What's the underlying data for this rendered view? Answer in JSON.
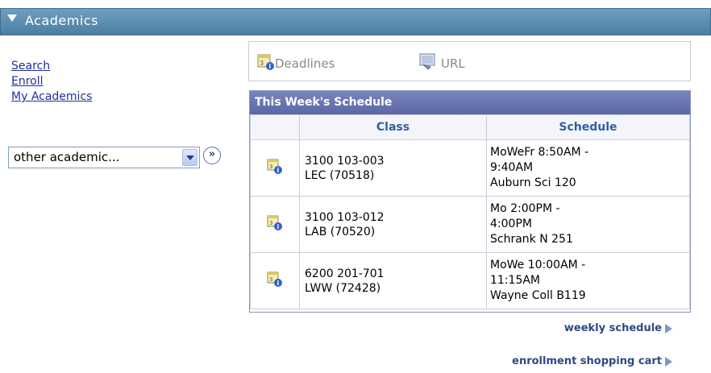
{
  "header": {
    "title": "Academics"
  },
  "links": [
    "Search",
    "Enroll",
    "My Academics"
  ],
  "dropdown": {
    "selected": "other academic..."
  },
  "go_button": {
    "label": "»"
  },
  "toolbar": {
    "deadlines_label": "Deadlines",
    "url_label": "URL"
  },
  "schedule": {
    "title": "This Week's Schedule",
    "columns": {
      "class": "Class",
      "schedule": "Schedule"
    },
    "rows": [
      {
        "class_line1": "3100 103-003",
        "class_line2": "LEC (70518)",
        "sched_line1": "MoWeFr 8:50AM -",
        "sched_line2": "9:40AM",
        "sched_line3": "Auburn Sci 120"
      },
      {
        "class_line1": "3100 103-012",
        "class_line2": "LAB (70520)",
        "sched_line1": "Mo 2:00PM -",
        "sched_line2": "4:00PM",
        "sched_line3": "Schrank N 251"
      },
      {
        "class_line1": "6200 201-701",
        "class_line2": "LWW (72428)",
        "sched_line1": "MoWe 10:00AM -",
        "sched_line2": "11:15AM",
        "sched_line3": "Wayne Coll B119"
      }
    ]
  },
  "bottom_links": {
    "weekly": "weekly schedule",
    "cart": "enrollment shopping cart"
  },
  "icons": [
    "triangle-down-icon",
    "deadlines-calendar-icon",
    "url-icon",
    "calendar-info-icon",
    "chevron-down-icon",
    "double-chevron-right-icon",
    "arrow-right-icon"
  ]
}
